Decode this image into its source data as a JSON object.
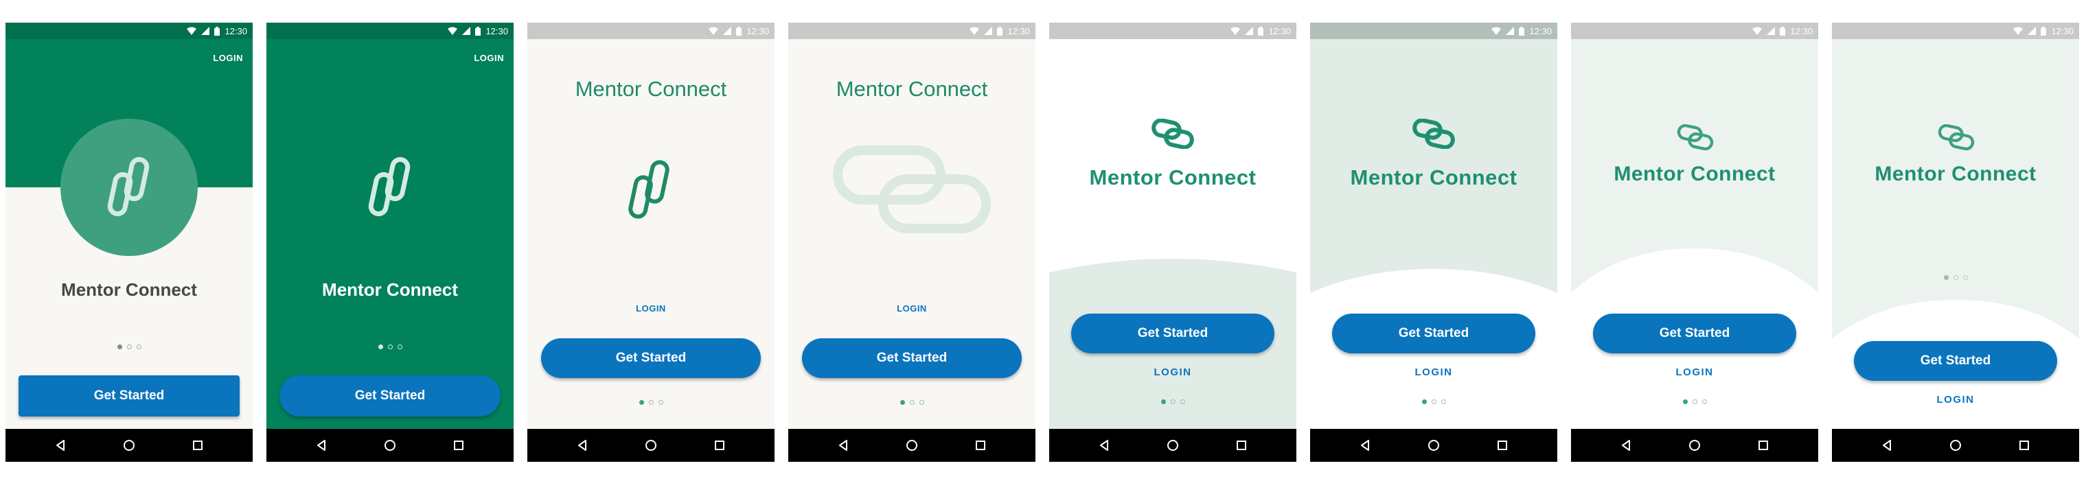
{
  "status_time": "12:30",
  "app_name": "Mentor Connect",
  "get_started_label": "Get Started",
  "login_label": "LOGIN",
  "colors": {
    "brand_green": "#02825a",
    "brand_green_light": "#3fa07f",
    "wordmark_green": "#1e9072",
    "button_blue": "#0a74bd",
    "offwhite_bg": "#f8f7f4",
    "pale_green_bg": "#e2ece7"
  },
  "screens": [
    {
      "variant": "A",
      "login_position": "top-right"
    },
    {
      "variant": "B",
      "login_position": "top-right"
    },
    {
      "variant": "C",
      "login_position": "above-button"
    },
    {
      "variant": "D",
      "login_position": "above-button"
    },
    {
      "variant": "E",
      "login_position": "below-button"
    },
    {
      "variant": "F",
      "login_position": "below-button"
    },
    {
      "variant": "G",
      "login_position": "below-button"
    },
    {
      "variant": "H",
      "login_position": "below-button"
    }
  ],
  "icons": [
    "wifi-icon",
    "signal-icon",
    "battery-icon",
    "chain-link-icon",
    "back-icon",
    "home-icon",
    "recents-icon"
  ]
}
